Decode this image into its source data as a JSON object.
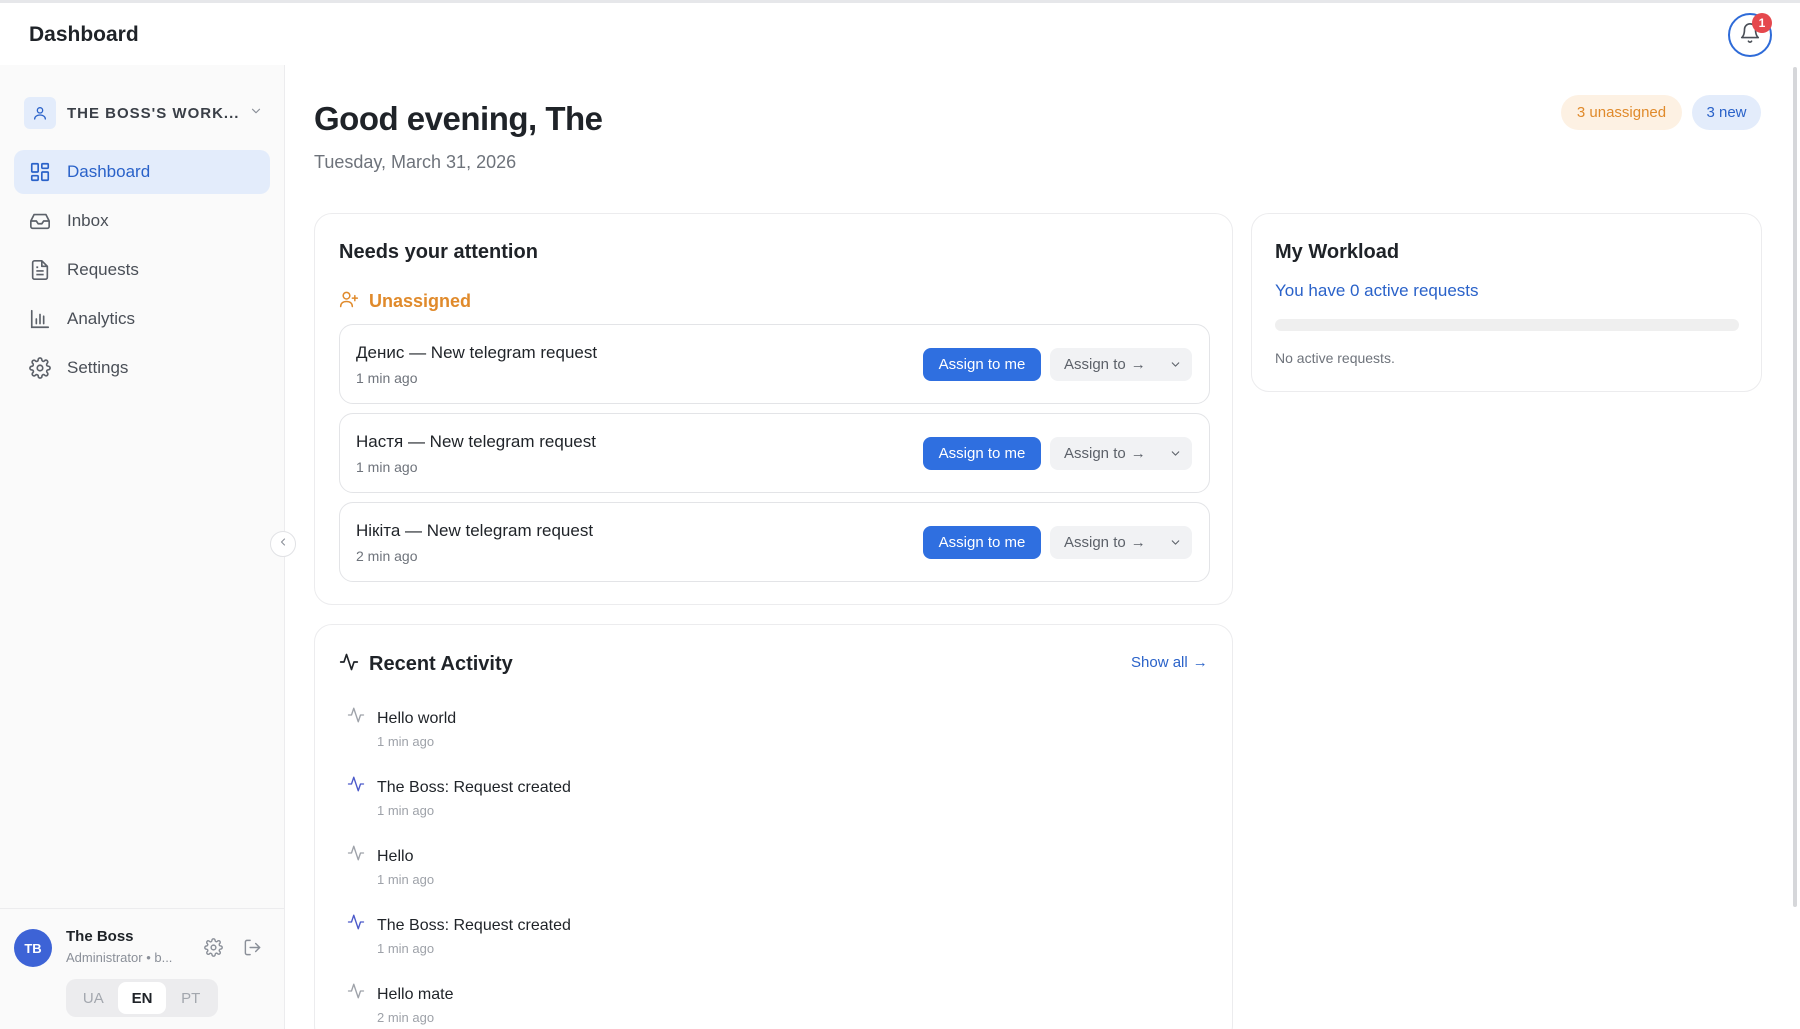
{
  "header": {
    "title": "Dashboard",
    "notification_count": "1"
  },
  "sidebar": {
    "workspace_name": "THE BOSS'S WORK...",
    "items": [
      {
        "label": "Dashboard",
        "icon": "grid-icon",
        "active": true
      },
      {
        "label": "Inbox",
        "icon": "inbox-icon",
        "active": false
      },
      {
        "label": "Requests",
        "icon": "document-icon",
        "active": false
      },
      {
        "label": "Analytics",
        "icon": "bar-chart-icon",
        "active": false
      },
      {
        "label": "Settings",
        "icon": "gear-icon",
        "active": false
      }
    ],
    "user": {
      "initials": "TB",
      "name": "The Boss",
      "role": "Administrator • b..."
    },
    "languages": [
      "UA",
      "EN",
      "PT"
    ],
    "active_language": "EN"
  },
  "main": {
    "greeting": "Good evening, The",
    "date": "Tuesday, March 31, 2026",
    "pills": {
      "unassigned": "3 unassigned",
      "new": "3 new"
    },
    "attention": {
      "title": "Needs your attention",
      "section_label": "Unassigned",
      "assign_me_label": "Assign to me",
      "assign_to_label": "Assign to",
      "arrow": "→",
      "requests": [
        {
          "title": "Денис — New telegram request",
          "time": "1 min ago"
        },
        {
          "title": "Настя — New telegram request",
          "time": "1 min ago"
        },
        {
          "title": "Нікіта — New telegram request",
          "time": "2 min ago"
        }
      ]
    },
    "workload": {
      "title": "My Workload",
      "summary": "You have 0 active requests",
      "progress": 0,
      "empty_text": "No active requests."
    },
    "activity": {
      "title": "Recent Activity",
      "show_all": "Show all",
      "arrow": "→",
      "items": [
        {
          "text": "Hello world",
          "time": "1 min ago",
          "highlight": false
        },
        {
          "text": "The Boss: Request created",
          "time": "1 min ago",
          "highlight": true
        },
        {
          "text": "Hello",
          "time": "1 min ago",
          "highlight": false
        },
        {
          "text": "The Boss: Request created",
          "time": "1 min ago",
          "highlight": true
        },
        {
          "text": "Hello mate",
          "time": "2 min ago",
          "highlight": false
        }
      ]
    }
  },
  "colors": {
    "accent": "#2f6fe0",
    "accent_soft": "#e3ecfb",
    "warning": "#e08a2b",
    "warning_soft": "#fdf1e3",
    "badge": "#e5484d",
    "activity_highlight": "#4b59c9",
    "activity_muted": "#9ea2a9"
  }
}
